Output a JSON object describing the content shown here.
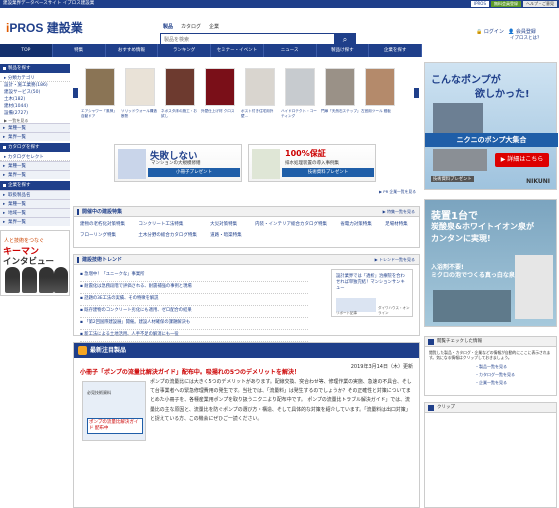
{
  "topbar": {
    "title": "建設業界データベースサイト イプロス建設業",
    "ipros": "IPROS",
    "register": "無料会員登録",
    "help": "ヘルプ・ご意見"
  },
  "header": {
    "logo_i": "i",
    "logo_rest": "PROS",
    "logo_sub": "建設業",
    "tabs": [
      "製品",
      "カタログ",
      "企業"
    ],
    "search_placeholder": "製品を検索",
    "login": "ログイン",
    "register": "会員登録",
    "forgot": "イプロスとは？"
  },
  "nav": [
    "TOP",
    "特集",
    "おすすめ情報",
    "ランキング",
    "セミナー・イベント",
    "ニュース",
    "製品け探す",
    "企業を探す"
  ],
  "sidebar": {
    "products_head": "製品を探す",
    "products_sub": "分類カテゴリ",
    "product_items": [
      "設計・施工業務(186)",
      "建設サービス(50)",
      "土木(182)",
      "建材(1044)",
      "設備(2727)",
      "..."
    ],
    "more1": "▶ 一覧を見る",
    "industry1": "業種一覧",
    "industry2": "業界一覧",
    "catalog_head": "カタログを探す",
    "catalog_sub": "カタログセレクト",
    "c1": "業種一覧",
    "c2": "業界一覧",
    "company_head": "企業を探す",
    "co1": "取扱製品名",
    "co2": "業種一覧",
    "co3": "地域一覧",
    "co4": "業界一覧",
    "banner_title": "人と技術をつなぐ",
    "banner_main": "キーマン",
    "banner_sub": "インタビュー"
  },
  "products": [
    "エアシャワー「風神」自動ドア",
    "ソリッドウォール構造断熱",
    "ネポスタ床の施工・お試し",
    "外壁仕上げ材 クロス",
    "ポスト付き住宅用外壁...",
    "ハイドロテクト・コーティング",
    "門扉「天然石ステップ」",
    "左官用ツール 鏝板"
  ],
  "ads": {
    "a_title": "失敗しない",
    "a_sub": "マンションの大規模修繕",
    "a_strip": "小冊子プレゼント",
    "b_title": "100%保証",
    "b_sub": "排水処理装置の導入事例集",
    "b_strip": "技術資料プレゼント",
    "footer": "▶ PR 企業一覧を見る"
  },
  "featured": {
    "head": "開催中の建設特集",
    "more": "▶ 特集一覧を見る",
    "links": [
      "建物の老朽化対策特集",
      "コンクリート工法特集",
      "大災対策特集",
      "内装・インテリア総合カタログ特集",
      "省電力対策特集",
      "足場材特集",
      "フローリング特集",
      "土木分野の総合カタログ特集",
      "道路・暗渠特集"
    ]
  },
  "trend": {
    "head": "建設技術トレンド",
    "more": "▶ トレンド一覧を見る",
    "items": [
      "急増中！「ユニークな」事業所",
      "耐震化は急務段階で評価される、耐震補強の事例と現場",
      "話題の3E工法の実績、その特徴を解説",
      "既存建物のコンクリート劣化にも適用、ゼロ配合の結果",
      "「第2回国際建設展」開催。建設人材確保の課題解決も",
      "新工法による土地活用、人手不足の解消にも一役"
    ],
    "ad_text": "設計業界では「透析」治療院を合わせれば単独完結！マンションサンキュー",
    "ad_cap1": "リポート記事",
    "ad_cap2": "ダイワハウス・オンライン"
  },
  "news": {
    "head": "最新注目製品",
    "date": "2019年3月14日（木）更新",
    "title": "小冊子「ポンプの流量比解決ガイド」配布中。吸揚れの5つのデメリットを解決！",
    "img_caption": "必見技術資料",
    "img_label": "ポンプの流量比解決ガイド 配布中",
    "body": "ポンプの流量比には大きく5つのデメリットがあります。配線交換、突合わせ等、修理作業の実施、急速の不具合、そして台事業者への緊急修理費用の発生です。当社では、「流量料」は発生するのでしょうか？その正確性と対策についてまとめた小冊子を、各種産業用ポンプを取り扱うニクニより配布中です。\nポンプの流量比トラブル解決ガイド」では、流量比の主な原因と、流量比を防ぐポンプの選び方・構造、そして具体的な対策を紹介しています。「流量料は出口対策」と捉えている方、この機会にぜひご一読ください。"
  },
  "right": {
    "pump_h1": "こんなポンプが",
    "pump_h2": "欲しかった!",
    "pump_mid": "ニクニのポンプ大集合",
    "pump_btn": "▶ 詳細はこちら",
    "pump_logo": "NIKUNI",
    "pump_apply": "技術資料プレゼント",
    "fill_h1": "装置1台で",
    "fill_h2": "炭酸泉&ホワイトイオン泉が",
    "fill_h3": "カンタンに実現!",
    "fill_s1": "入浴剤不要!",
    "fill_s2": "ミクロの泡でつくる真っ白な泉",
    "recent_head": "閲覧チェックした情報",
    "recent_body": "閲覧した製品・カタログ・企業などの情報が自動的にここに表示されます。気になる情報はクリップしておきましょう。",
    "recent_link1": "・製品一覧を見る",
    "recent_link2": "・カタログ一覧を見る",
    "recent_link3": "・企業一覧を見る",
    "clip_head": "クリップ"
  }
}
